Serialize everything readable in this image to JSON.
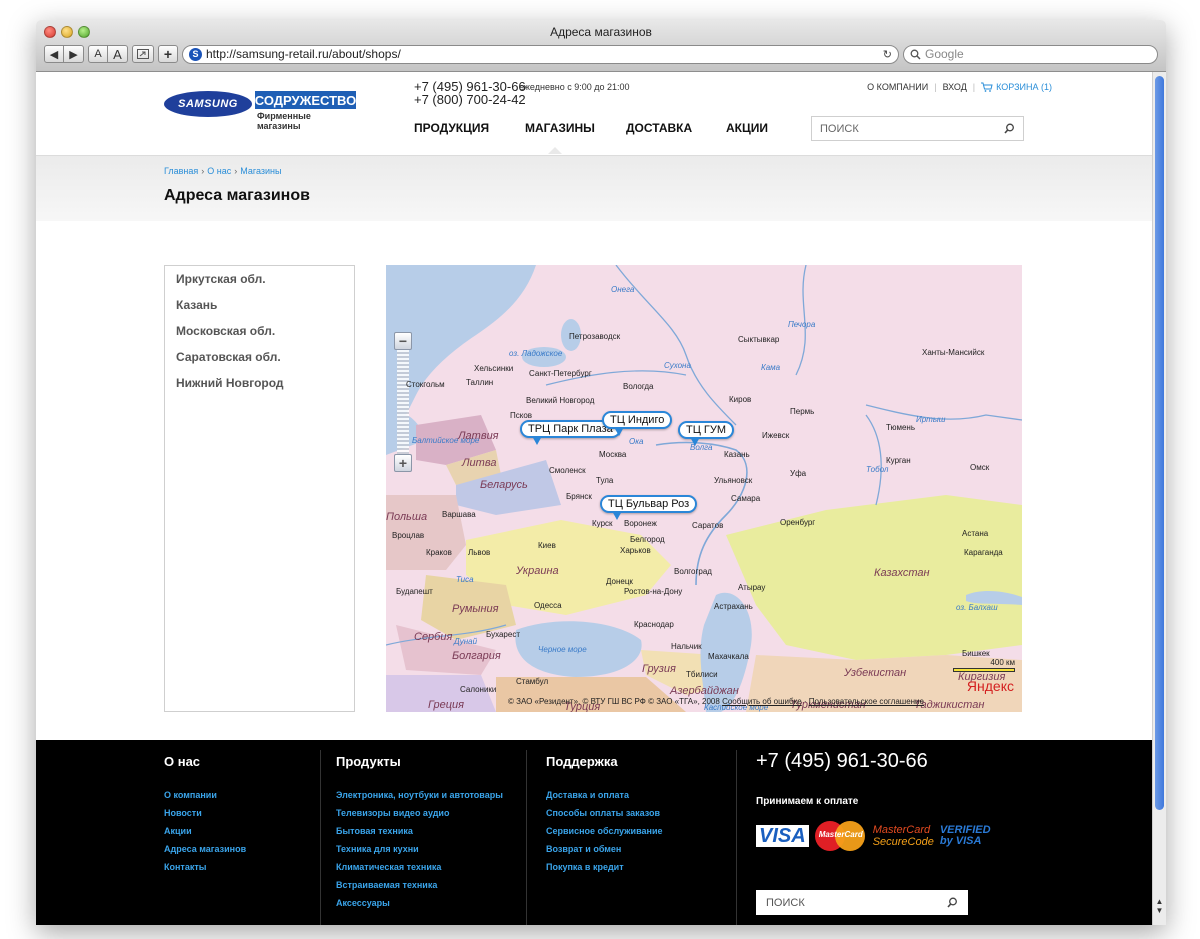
{
  "browser": {
    "title": "Адреса магазинов",
    "url": "http://samsung-retail.ru/about/shops/",
    "search_placeholder": "Google",
    "buttons": {
      "back": "◀",
      "forward": "▶",
      "font_small": "A",
      "font_large": "A",
      "add": "+"
    },
    "reload_icon": "↻",
    "favicon_letter": "S"
  },
  "header": {
    "logo_samsung": "SAMSUNG",
    "logo_brand": "СОДРУЖЕСТВО",
    "logo_sub": "Фирменные магазины",
    "phone1": "+7 (495) 961-30-66",
    "phone2": "+7 (800) 700-24-42",
    "hours": "ежедневно с 9:00 до 21:00",
    "links": [
      "О КОМПАНИИ",
      "ВХОД"
    ],
    "cart": "КОРЗИНА (1)",
    "nav": [
      "ПРОДУКЦИЯ",
      "МАГАЗИНЫ",
      "ДОСТАВКА",
      "АКЦИИ"
    ],
    "search_placeholder": "ПОИСК"
  },
  "breadcrumb": [
    "Главная",
    "О нас",
    "Магазины"
  ],
  "page_title": "Адреса магазинов",
  "regions": [
    "Иркутская обл.",
    "Казань",
    "Московская обл.",
    "Саратовская обл.",
    "Нижний Новгород"
  ],
  "map": {
    "zoom_in": "+",
    "zoom_out": "−",
    "balloons": [
      "ТРЦ Парк Плаза",
      "ТЦ Индиго",
      "ТЦ ГУМ",
      "ТЦ Бульвар Роз"
    ],
    "cities": [
      "Петрозаводск",
      "Сыктывкар",
      "Хельсинки",
      "Санкт-Петербург",
      "Ханты-Мансийск",
      "Стокгольм",
      "Таллин",
      "Вологда",
      "Киров",
      "Великий Новгород",
      "Пермь",
      "Псков",
      "Тюмень",
      "Ижевск",
      "Москва",
      "Казань",
      "Курган",
      "Смоленск",
      "Тула",
      "Ульяновск",
      "Уфа",
      "Омск",
      "Брянск",
      "Самара",
      "Варшава",
      "Курск",
      "Воронеж",
      "Саратов",
      "Оренбург",
      "Астана",
      "Вроцлав",
      "Белгород",
      "Краков",
      "Львов",
      "Киев",
      "Харьков",
      "Караганда",
      "Волгоград",
      "Будапешт",
      "Донецк",
      "Ростов-на-Дону",
      "Атырау",
      "Одесса",
      "Астрахань",
      "Краснодар",
      "Бухарест",
      "Нальчик",
      "Махачкала",
      "Бишкек",
      "Тбилиси",
      "Стамбул",
      "Салоники"
    ],
    "countries": [
      "Латвия",
      "Литва",
      "Беларусь",
      "Польша",
      "Украина",
      "Румыния",
      "Сербия",
      "Болгария",
      "Грузия",
      "Казахстан",
      "Узбекистан",
      "Азербайджан",
      "Туркменистан",
      "Таджикистан",
      "Греция",
      "Турция",
      "Киргизия"
    ],
    "waters": [
      "оз. Ладожское",
      "Сухона",
      "Кама",
      "Печора",
      "Онега",
      "Иртыш",
      "Тобол",
      "Волга",
      "Ока",
      "Черное море",
      "оз. Балхаш",
      "Каспийское море",
      "Балтийское море",
      "Тиса",
      "Дунай"
    ],
    "copyright": "© ЗАО «Резидент», © ВТУ ГШ ВС РФ © ЗАО «ТГА», 2008",
    "report_error": "Сообщить об ошибке",
    "agreement": "Пользовательское соглашение",
    "scale": "400 км",
    "yandex": "Яндекс"
  },
  "footer": {
    "about": {
      "title": "О нас",
      "links": [
        "О компании",
        "Новости",
        "Акции",
        "Адреса магазинов",
        "Контакты"
      ]
    },
    "products": {
      "title": "Продукты",
      "links": [
        "Электроника, ноутбуки и автотовары",
        "Телевизоры видео аудио",
        "Бытовая техника",
        "Техника для кухни",
        "Климатическая техника",
        "Встраиваемая техника",
        "Аксессуары"
      ]
    },
    "support": {
      "title": "Поддержка",
      "links": [
        "Доставка и оплата",
        "Способы оплаты заказов",
        "Сервисное обслуживание",
        "Возврат и обмен",
        "Покупка в кредит"
      ]
    },
    "phone": "+7 (495) 961-30-66",
    "pay_title": "Принимаем к оплате",
    "cards": {
      "visa": "VISA",
      "mastercard": "MasterCard",
      "securecode_1": "MasterCard",
      "securecode_2": "SecureCode",
      "vbv_1": "VERIFIED",
      "vbv_2": "by VISA"
    },
    "search_placeholder": "ПОИСК"
  },
  "colors": {
    "link": "#2a8ed8",
    "brand": "#1f3f9b",
    "footer_bg": "#000000",
    "balloon_border": "#2a86d8"
  }
}
